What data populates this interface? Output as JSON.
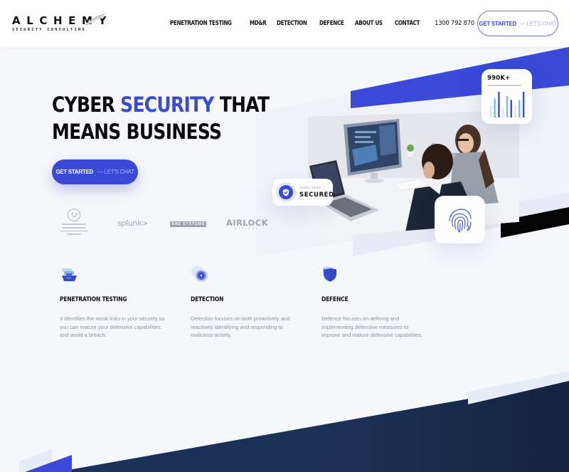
{
  "header": {
    "logo": {
      "name": "ALCHEMY",
      "tagline": "SECURITY CONSULTING"
    },
    "nav": [
      {
        "label": "PENETRATION TESTING"
      },
      {
        "label": "MD&R"
      },
      {
        "label": "DETECTION"
      },
      {
        "label": "DEFENCE"
      },
      {
        "label": "ABOUT US"
      },
      {
        "label": "CONTACT"
      }
    ],
    "phone": "1300 792 870",
    "cta": {
      "primary": "GET STARTED",
      "secondary": "— LET'S CHAT"
    }
  },
  "hero": {
    "title_prefix": "CYBER ",
    "title_accent": "SECURITY",
    "title_suffix": " THAT",
    "title_line2": "MEANS BUSINESS",
    "cta": {
      "primary": "GET STARTED",
      "secondary": "— LET'S CHAT"
    }
  },
  "partners": [
    {
      "name": "government-of-south-australia",
      "icon": "crest-icon"
    },
    {
      "name": "splunk",
      "label": "splunk>"
    },
    {
      "name": "bae-systems",
      "label": "BAE SYSTEMS"
    },
    {
      "name": "airlock-digital",
      "label": "AIRLOCK",
      "sublabel": "DIGITAL"
    }
  ],
  "widgets": {
    "stat": {
      "value": "990K+",
      "bars": [
        {
          "level": 0.45,
          "tone": "faint"
        },
        {
          "level": 0.7,
          "tone": "light"
        },
        {
          "level": 0.95,
          "tone": "dark"
        },
        {
          "level": 0.35,
          "tone": "faint"
        },
        {
          "level": 0.8,
          "tone": "light"
        },
        {
          "level": 0.65,
          "tone": "dark"
        },
        {
          "level": 0.45,
          "tone": "faint"
        },
        {
          "level": 0.65,
          "tone": "light"
        },
        {
          "level": 0.95,
          "tone": "dark"
        }
      ]
    },
    "status": {
      "label": "System Status",
      "value": "SECURED"
    },
    "fingerprint": {
      "icon": "fingerprint-icon"
    }
  },
  "services": [
    {
      "title": "PENETRATION TESTING",
      "icon": "layers-icon",
      "body": "It identifies the weak links in your security so you can mature your defensive capabilities and avoid a breach."
    },
    {
      "title": "DETECTION",
      "icon": "radar-icon",
      "body": "Detection focuses on both proactively and reactively identifying and responding to malicious activity."
    },
    {
      "title": "DEFENCE",
      "icon": "shield-icon",
      "body": "Defence focuses on defining and implementing defensive measures to improve and mature defensive capabilities."
    }
  ],
  "colors": {
    "accent": "#3b4bcf",
    "accent_bright": "#3a49d6",
    "navy": "#1b2f52",
    "text": "#111111",
    "muted": "#8d92a0",
    "bar_dark": "#3b4bcf",
    "bar_light": "#7fb8ea",
    "bar_faint": "#dbe7f7"
  }
}
